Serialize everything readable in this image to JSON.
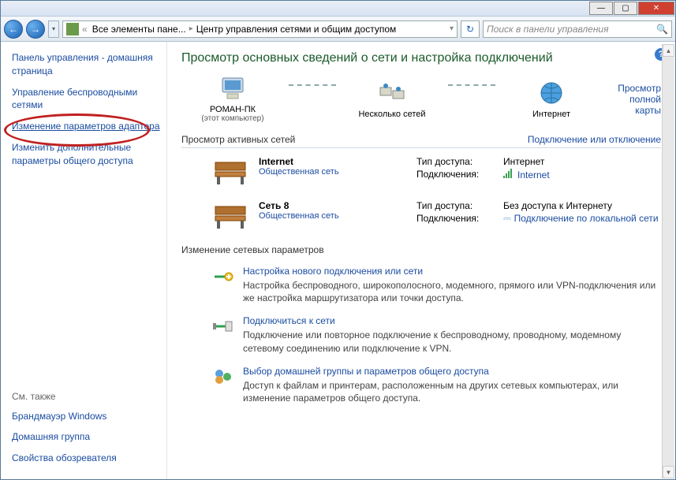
{
  "titlebar": {
    "min": "—",
    "max": "▢",
    "close": "✕"
  },
  "navbar": {
    "back_glyph": "←",
    "fwd_glyph": "→",
    "dropdown_glyph": "▾",
    "crumb1": "Все элементы пане...",
    "crumb2": "Центр управления сетями и общим доступом",
    "sep": "▸",
    "refresh_glyph": "↻",
    "search_placeholder": "Поиск в панели управления",
    "search_glyph": "🔍"
  },
  "sidebar": {
    "home": "Панель управления - домашняя страница",
    "wireless": "Управление беспроводными сетями",
    "adapter": "Изменение параметров адаптера",
    "sharing": "Изменить дополнительные параметры общего доступа",
    "seealso": "См. также",
    "firewall": "Брандмауэр Windows",
    "homegroup": "Домашняя группа",
    "ieopts": "Свойства обозревателя"
  },
  "main": {
    "help_glyph": "?",
    "heading": "Просмотр основных сведений о сети и настройка подключений",
    "map": {
      "node1": "РОМАН-ПК",
      "node1_sub": "(этот компьютер)",
      "node2": "Несколько сетей",
      "node3": "Интернет",
      "full_map_link": "Просмотр полной карты"
    },
    "active_head": "Просмотр активных сетей",
    "conn_link": "Подключение или отключение",
    "nets": [
      {
        "name": "Internet",
        "type": "Общественная сеть",
        "access_lbl": "Тип доступа:",
        "access_val": "Интернет",
        "conn_lbl": "Подключения:",
        "conn_val": "Internet"
      },
      {
        "name": "Сеть  8",
        "type": "Общественная сеть",
        "access_lbl": "Тип доступа:",
        "access_val": "Без доступа к Интернету",
        "conn_lbl": "Подключения:",
        "conn_val": "Подключение по локальной сети"
      }
    ],
    "change_head": "Изменение сетевых параметров",
    "tasks": [
      {
        "title": "Настройка нового подключения или сети",
        "desc": "Настройка беспроводного, широкополосного, модемного, прямого или VPN-подключения или же настройка маршрутизатора или точки доступа."
      },
      {
        "title": "Подключиться к сети",
        "desc": "Подключение или повторное подключение к беспроводному, проводному, модемному сетевому соединению или подключение к VPN."
      },
      {
        "title": "Выбор домашней группы и параметров общего доступа",
        "desc": "Доступ к файлам и принтерам, расположенным на других сетевых компьютерах, или изменение параметров общего доступа."
      }
    ]
  }
}
